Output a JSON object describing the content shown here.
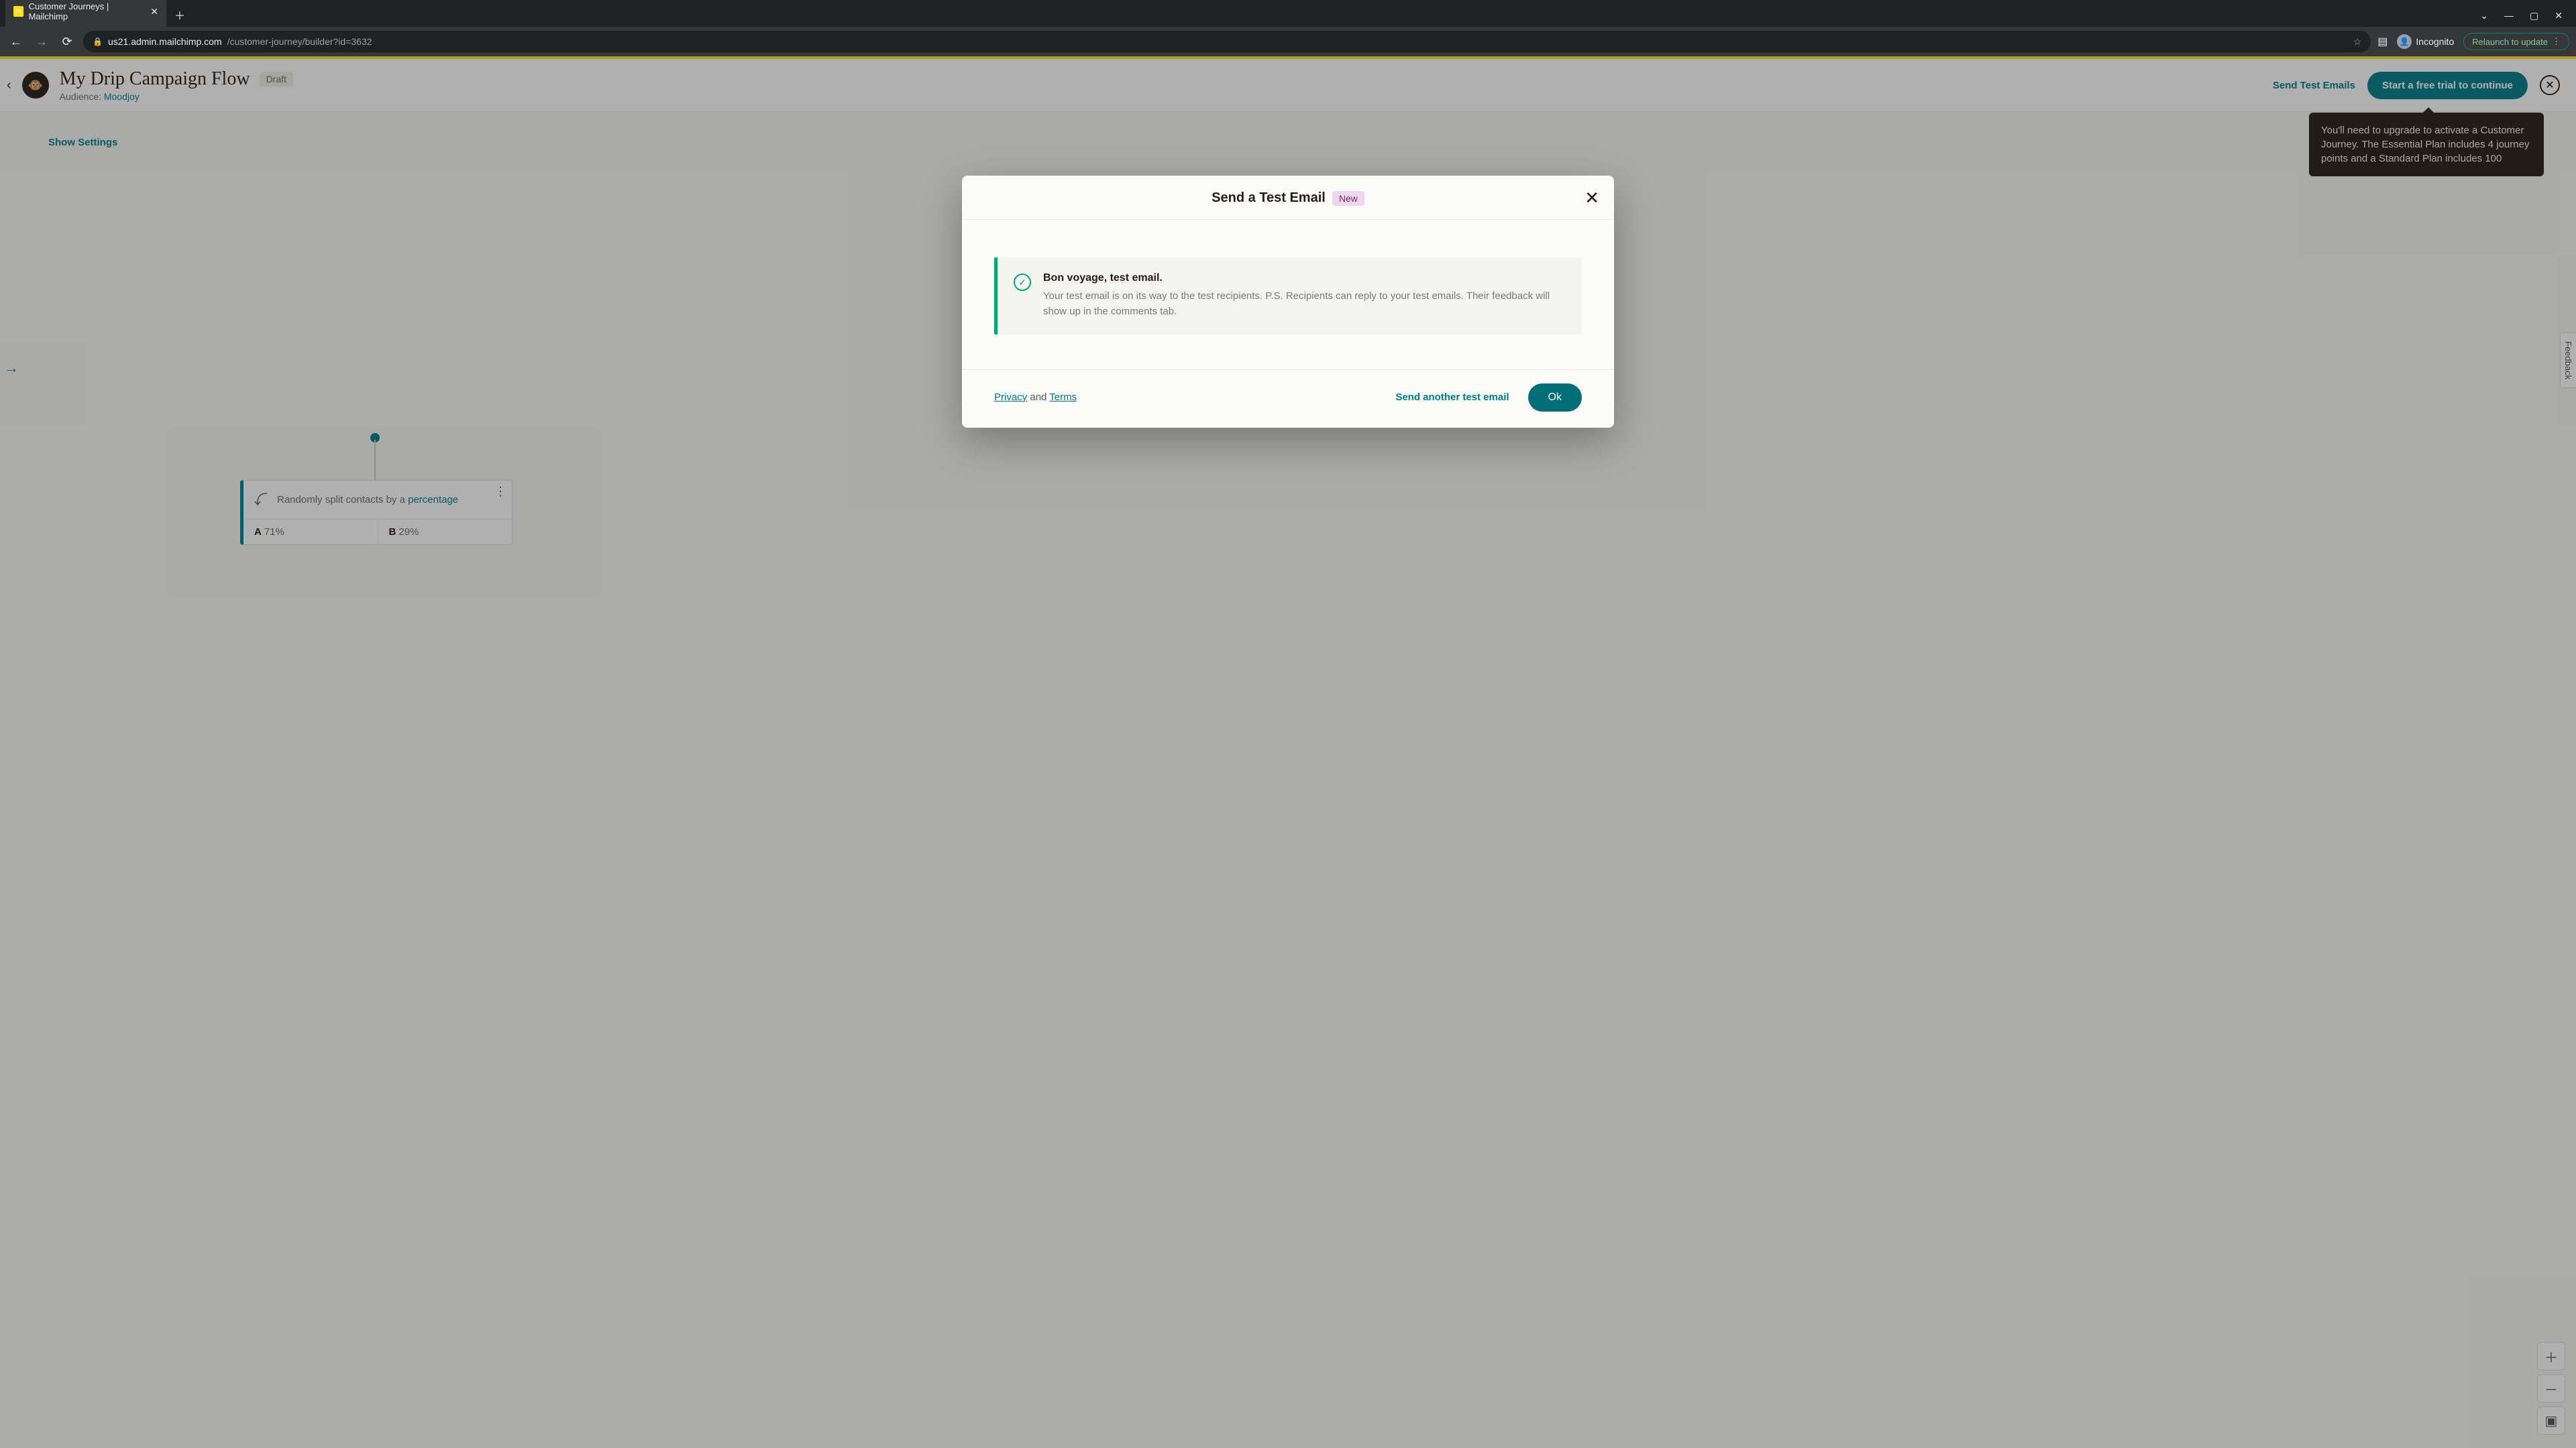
{
  "browser": {
    "tab_title": "Customer Journeys | Mailchimp",
    "url_host": "us21.admin.mailchimp.com",
    "url_path": "/customer-journey/builder?id=3632",
    "incognito_label": "Incognito",
    "relaunch_label": "Relaunch to update"
  },
  "header": {
    "title": "My Drip Campaign Flow",
    "status_badge": "Draft",
    "audience_label": "Audience:",
    "audience_name": "Moodjoy",
    "send_test_label": "Send Test Emails",
    "cta_label": "Start a free trial to continue"
  },
  "tooltip": {
    "text": "You'll need to upgrade to activate a Customer Journey. The Essential Plan includes 4 journey points and a Standard Plan includes 100"
  },
  "canvas": {
    "show_settings": "Show Settings",
    "node": {
      "text_prefix": "Randomly split contacts by a ",
      "text_link": "percentage",
      "split_a_label": "A",
      "split_a_value": "71%",
      "split_b_label": "B",
      "split_b_value": "29%"
    },
    "feedback_label": "Feedback"
  },
  "modal": {
    "title": "Send a Test Email",
    "badge": "New",
    "alert_heading": "Bon voyage, test email.",
    "alert_body": "Your test email is on its way to the test recipients. P.S. Recipients can reply to your test emails. Their feedback will show up in the comments tab.",
    "privacy": "Privacy",
    "and": " and ",
    "terms": "Terms",
    "send_another": "Send another test email",
    "ok": "Ok"
  }
}
